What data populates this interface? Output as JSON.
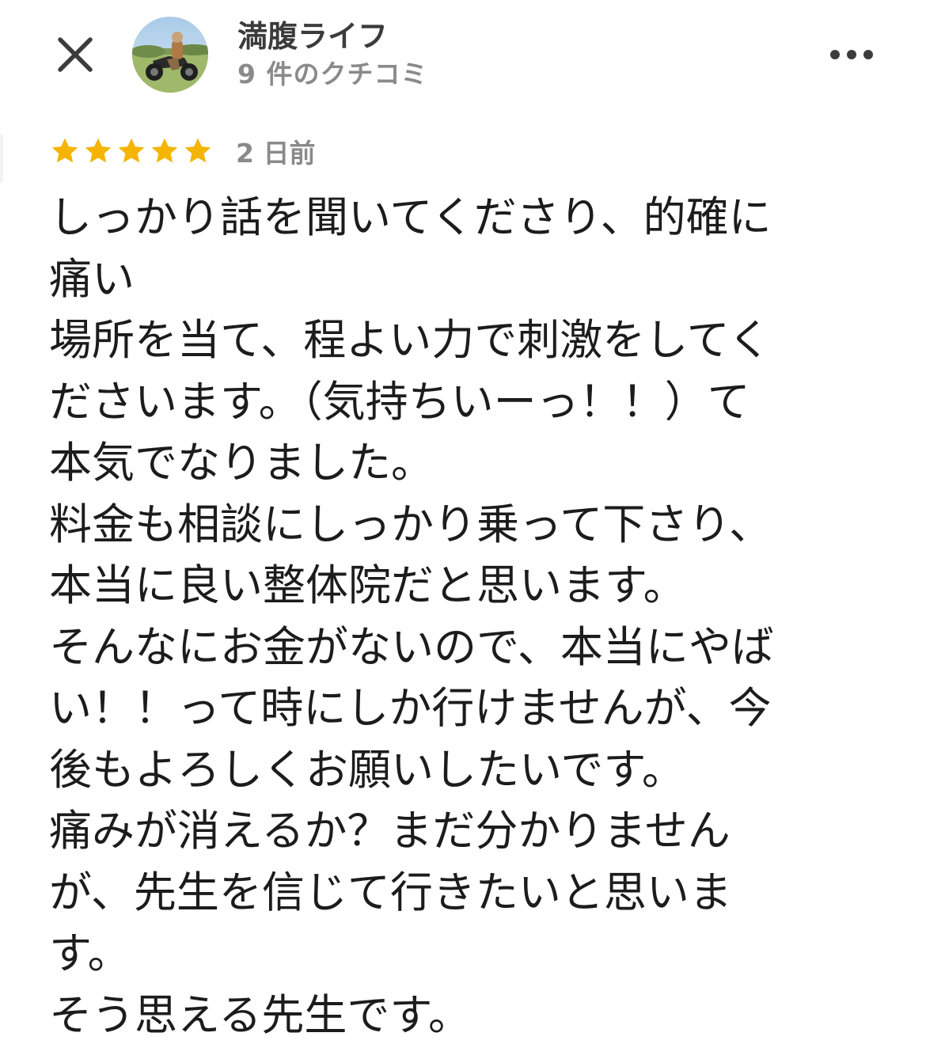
{
  "header": {
    "close_icon": "close-icon",
    "author_name": "満腹ライフ",
    "review_count": "9 件のクチコミ",
    "more_icon": "more-horizontal-icon"
  },
  "review": {
    "rating": 5,
    "rating_max": 5,
    "star_color": "#f5b400",
    "date": "2 日前",
    "text": "しっかり話を聞いてくださり、的確に\n痛い\n場所を当て、程よい力で刺激をしてく\nださいます。（気持ちいーっ！！）て\n本気でなりました。\n料金も相談にしっかり乗って下さり、\n本当に良い整体院だと思います。\nそんなにお金がないので、本当にやば\nい！！って時にしか行けませんが、今\n後もよろしくお願いしたいです。\n痛みが消えるか？まだ分かりません\nが、先生を信じて行きたいと思いま\nす。\nそう思える先生です。"
  }
}
